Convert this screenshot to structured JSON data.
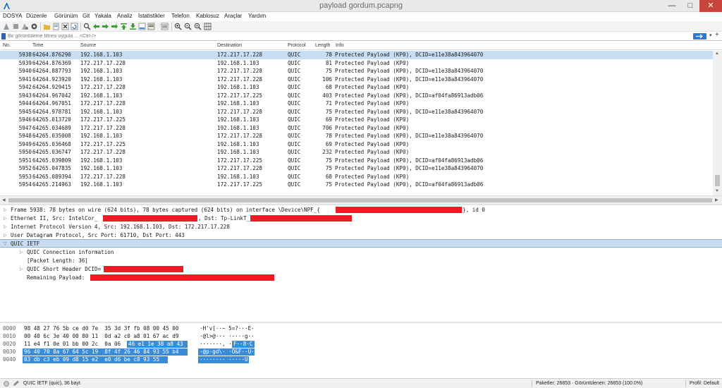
{
  "window": {
    "title": "payload gordum.pcapng",
    "min": "—",
    "max": "□",
    "close": "✕"
  },
  "menu": [
    "DOSYA",
    "Düzenle",
    "Görünüm",
    "Git",
    "Yakala",
    "Analiz",
    "İstatistikler",
    "Telefon",
    "Kablosuz",
    "Araçlar",
    "Yardım"
  ],
  "toolbar": {
    "icons": [
      "shark-fin-start-icon",
      "stop-icon",
      "restart-icon",
      "gear-options-icon",
      "open-file-icon",
      "file-icon",
      "close-file-icon",
      "reload-icon",
      "search-icon",
      "back-arrow-icon",
      "forward-arrow-icon",
      "goto-packet-icon",
      "goto-first-icon",
      "goto-last-icon",
      "autoscroll-icon",
      "colorize-icon",
      "zoom-in-icon",
      "zoom-out-icon",
      "zoom-reset-icon",
      "resize-columns-icon"
    ]
  },
  "filter": {
    "placeholder": "Bir görüntüleme filtresi uygula ... <Ctrl-/>",
    "value": "",
    "apply_color": "#2a7ad4"
  },
  "packet_list": {
    "columns": {
      "no": "No.",
      "time": "Time",
      "source": "Source",
      "destination": "Destination",
      "protocol": "Protocol",
      "length": "Length",
      "info": "Info"
    },
    "rows": [
      {
        "no": "5938",
        "time": "64264.876290",
        "src": "192.168.1.103",
        "dst": "172.217.17.228",
        "proto": "QUIC",
        "len": "78",
        "info": "Protected Payload (KP0), DCID=e11e38a843964070",
        "selected": true
      },
      {
        "no": "5939",
        "time": "64264.876369",
        "src": "172.217.17.228",
        "dst": "192.168.1.103",
        "proto": "QUIC",
        "len": "81",
        "info": "Protected Payload (KP0)"
      },
      {
        "no": "5940",
        "time": "64264.887793",
        "src": "192.168.1.103",
        "dst": "172.217.17.228",
        "proto": "QUIC",
        "len": "75",
        "info": "Protected Payload (KP0), DCID=e11e38a843964070"
      },
      {
        "no": "5941",
        "time": "64264.923920",
        "src": "192.168.1.103",
        "dst": "172.217.17.228",
        "proto": "QUIC",
        "len": "106",
        "info": "Protected Payload (KP0), DCID=e11e38a843964070"
      },
      {
        "no": "5942",
        "time": "64264.929415",
        "src": "172.217.17.228",
        "dst": "192.168.1.103",
        "proto": "QUIC",
        "len": "68",
        "info": "Protected Payload (KP0)"
      },
      {
        "no": "5943",
        "time": "64264.967042",
        "src": "192.168.1.103",
        "dst": "172.217.17.225",
        "proto": "QUIC",
        "len": "403",
        "info": "Protected Payload (KP0), DCID=af04fa86913adb06"
      },
      {
        "no": "5944",
        "time": "64264.967051",
        "src": "172.217.17.228",
        "dst": "192.168.1.103",
        "proto": "QUIC",
        "len": "71",
        "info": "Protected Payload (KP0)"
      },
      {
        "no": "5945",
        "time": "64264.978781",
        "src": "192.168.1.103",
        "dst": "172.217.17.228",
        "proto": "QUIC",
        "len": "75",
        "info": "Protected Payload (KP0), DCID=e11e38a843964070"
      },
      {
        "no": "5946",
        "time": "64265.013720",
        "src": "172.217.17.225",
        "dst": "192.168.1.103",
        "proto": "QUIC",
        "len": "69",
        "info": "Protected Payload (KP0)"
      },
      {
        "no": "5947",
        "time": "64265.034689",
        "src": "172.217.17.228",
        "dst": "192.168.1.103",
        "proto": "QUIC",
        "len": "706",
        "info": "Protected Payload (KP0)"
      },
      {
        "no": "5948",
        "time": "64265.035008",
        "src": "192.168.1.103",
        "dst": "172.217.17.228",
        "proto": "QUIC",
        "len": "78",
        "info": "Protected Payload (KP0), DCID=e11e38a843964070"
      },
      {
        "no": "5949",
        "time": "64265.036468",
        "src": "172.217.17.225",
        "dst": "192.168.1.103",
        "proto": "QUIC",
        "len": "69",
        "info": "Protected Payload (KP0)"
      },
      {
        "no": "5950",
        "time": "64265.036747",
        "src": "172.217.17.228",
        "dst": "192.168.1.103",
        "proto": "QUIC",
        "len": "232",
        "info": "Protected Payload (KP0)"
      },
      {
        "no": "5951",
        "time": "64265.039809",
        "src": "192.168.1.103",
        "dst": "172.217.17.225",
        "proto": "QUIC",
        "len": "75",
        "info": "Protected Payload (KP0), DCID=af04fa86913adb06"
      },
      {
        "no": "5952",
        "time": "64265.047835",
        "src": "192.168.1.103",
        "dst": "172.217.17.228",
        "proto": "QUIC",
        "len": "75",
        "info": "Protected Payload (KP0), DCID=e11e38a843964070"
      },
      {
        "no": "5953",
        "time": "64265.089394",
        "src": "172.217.17.228",
        "dst": "192.168.1.103",
        "proto": "QUIC",
        "len": "68",
        "info": "Protected Payload (KP0)"
      },
      {
        "no": "5954",
        "time": "64265.214963",
        "src": "192.168.1.103",
        "dst": "172.217.17.225",
        "proto": "QUIC",
        "len": "75",
        "info": "Protected Payload (KP0), DCID=af04fa86913adb06"
      }
    ]
  },
  "details": {
    "frame": {
      "pre": "Frame 5938: 78 bytes on wire (624 bits), 78 bytes captured (624 bits) on interface \\Device\\NPF_{",
      "post": "}, id 0"
    },
    "ethernet": {
      "pre": "Ethernet II, Src: IntelCor_",
      "mid": ", Dst: Tp-LinkT_"
    },
    "ip": "Internet Protocol Version 4, Src: 192.168.1.103, Dst: 172.217.17.228",
    "udp": "User Datagram Protocol, Src Port: 61710, Dst Port: 443",
    "quic": "QUIC IETF",
    "quic_conn": "QUIC Connection information",
    "packet_length": "[Packet Length: 36]",
    "short_header": "QUIC Short Header DCID=",
    "remaining": "Remaining Payload: ",
    "redaction_color": "#ed1c24"
  },
  "bytes": {
    "rows": [
      {
        "off": "0000",
        "hex": "98 48 27 76 5b ce d0 7e  35 3d 3f fb 08 00 45 00",
        "ascii": "·H'v[··~ 5=?···E·"
      },
      {
        "off": "0010",
        "hex": "00 40 6c 3e 40 00 80 11  0d a2 c0 a8 01 67 ac d9",
        "ascii": "·@l>@··· ·····g··"
      },
      {
        "off": "0020",
        "hex_a": "11 e4 f1 0e 01 bb 00 2c  0a 06 ",
        "hex_b": "46 e1 1e 38 a8 43",
        "ascii_a": "·······, ··",
        "ascii_b": "F··8·C"
      },
      {
        "off": "0030",
        "hex": "96 40 70 8a 67 64 5c 19  8f 4f 26 46 84 93 55 b4",
        "ascii": "·@p·gd\\· ·O&F··U·"
      },
      {
        "off": "0040",
        "hex": "03 db c3 eb 09 d8 15 e2  e0 d6 be c8 93 55",
        "ascii": "········ ·····U"
      }
    ],
    "highlight_color": "#3a8bd8"
  },
  "status": {
    "left": "QUIC IETF (quic), 36 bayt",
    "stats": "Paketler: 26853 · Görüntülenen: 26853 (100.0%)",
    "profile": "Profil: Default"
  }
}
